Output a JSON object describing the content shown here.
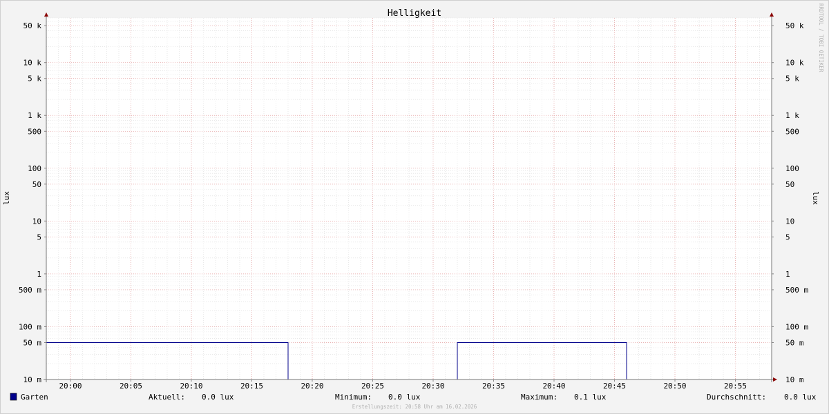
{
  "chart_data": {
    "type": "line",
    "title": "Helligkeit",
    "ylabel": "lux",
    "yscale": "log",
    "ylim": [
      0.01,
      70000
    ],
    "y_ticks": [
      {
        "value": 50000,
        "label": "50 k"
      },
      {
        "value": 10000,
        "label": "10 k"
      },
      {
        "value": 5000,
        "label": "5 k"
      },
      {
        "value": 1000,
        "label": "1 k"
      },
      {
        "value": 500,
        "label": "500"
      },
      {
        "value": 100,
        "label": "100"
      },
      {
        "value": 50,
        "label": "50"
      },
      {
        "value": 10,
        "label": "10"
      },
      {
        "value": 5,
        "label": "5"
      },
      {
        "value": 1,
        "label": "1"
      },
      {
        "value": 0.5,
        "label": "500 m"
      },
      {
        "value": 0.1,
        "label": "100 m"
      },
      {
        "value": 0.05,
        "label": "50 m"
      },
      {
        "value": 0.01,
        "label": "10 m"
      }
    ],
    "x_ticks": [
      "20:00",
      "20:05",
      "20:10",
      "20:15",
      "20:20",
      "20:25",
      "20:30",
      "20:35",
      "20:40",
      "20:45",
      "20:50",
      "20:55"
    ],
    "xlim": [
      "19:58",
      "20:58"
    ],
    "grid": true,
    "series": [
      {
        "name": "Garten",
        "color": "#00008b",
        "step": true,
        "points": [
          {
            "x": "19:58",
            "y": 0.05
          },
          {
            "x": "20:18",
            "y": 0.01
          },
          {
            "x": "20:32",
            "y": 0.05
          },
          {
            "x": "20:46",
            "y": 0.01
          },
          {
            "x": "20:58",
            "y": 0.01
          }
        ]
      }
    ]
  },
  "legend": {
    "series_name": "Garten",
    "swatch_color": "#00008b",
    "stats": [
      {
        "label": "Aktuell:",
        "value": "0.0 lux"
      },
      {
        "label": "Minimum:",
        "value": "0.0 lux"
      },
      {
        "label": "Maximum:",
        "value": "0.1 lux"
      },
      {
        "label": "Durchschnitt:",
        "value": "0.0 lux"
      }
    ]
  },
  "footer": "Erstellungszeit: 20:58 Uhr am 16.02.2026",
  "watermark": "RRDTOOL / TOBI OETIKER"
}
